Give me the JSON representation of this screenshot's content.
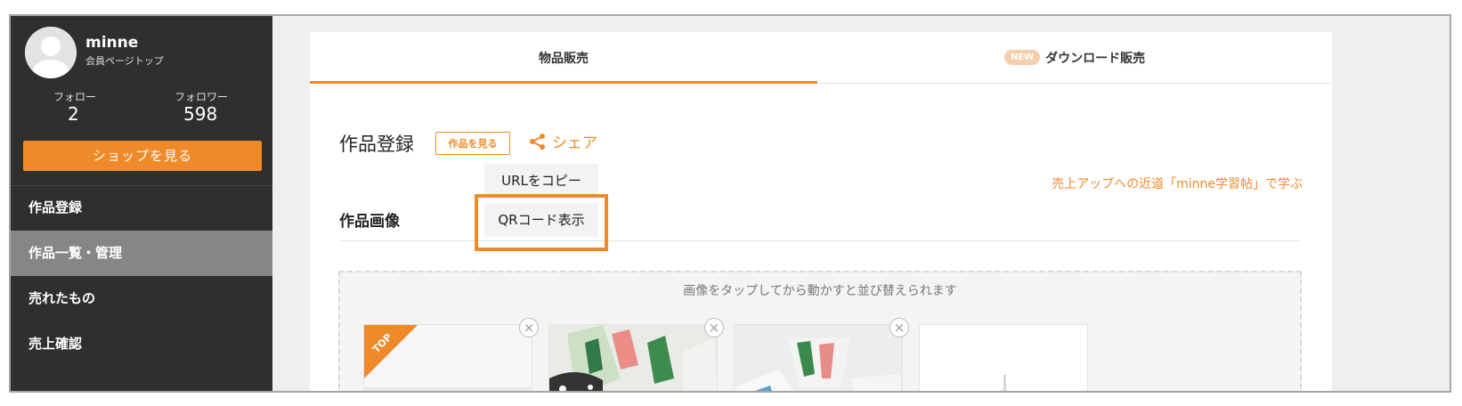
{
  "sidebar": {
    "username": "minne",
    "member_top": "会員ページトップ",
    "following_label": "フォロー",
    "following_count": "2",
    "followers_label": "フォロワー",
    "followers_count": "598",
    "shop_button": "ショップを見る",
    "nav": [
      {
        "label": "作品登録",
        "active": false
      },
      {
        "label": "作品一覧・管理",
        "active": true
      },
      {
        "label": "売れたもの",
        "active": false
      },
      {
        "label": "売上確認",
        "active": false
      }
    ]
  },
  "tabs": {
    "physical": "物品販売",
    "new_badge": "NEW",
    "download": "ダウンロード販売"
  },
  "main": {
    "title": "作品登録",
    "view_button": "作品を見る",
    "share_label": "シェア",
    "tip_link": "売上アップへの近道「minne学習帖」で学ぶ",
    "section_label": "作品画像",
    "drop_hint": "画像をタップしてから動かすと並び替えられます",
    "top_badge": "TOP"
  },
  "share_menu": {
    "copy_url": "URLをコピー",
    "show_qr": "QRコード表示"
  },
  "colors": {
    "accent": "#ef8a2a",
    "sidebar_bg": "#2f2f2f",
    "sidebar_active": "#868686"
  },
  "icons": {
    "share": "share-icon",
    "delete": "close-circle-icon",
    "add": "plus-icon",
    "avatar": "user-avatar-icon"
  }
}
